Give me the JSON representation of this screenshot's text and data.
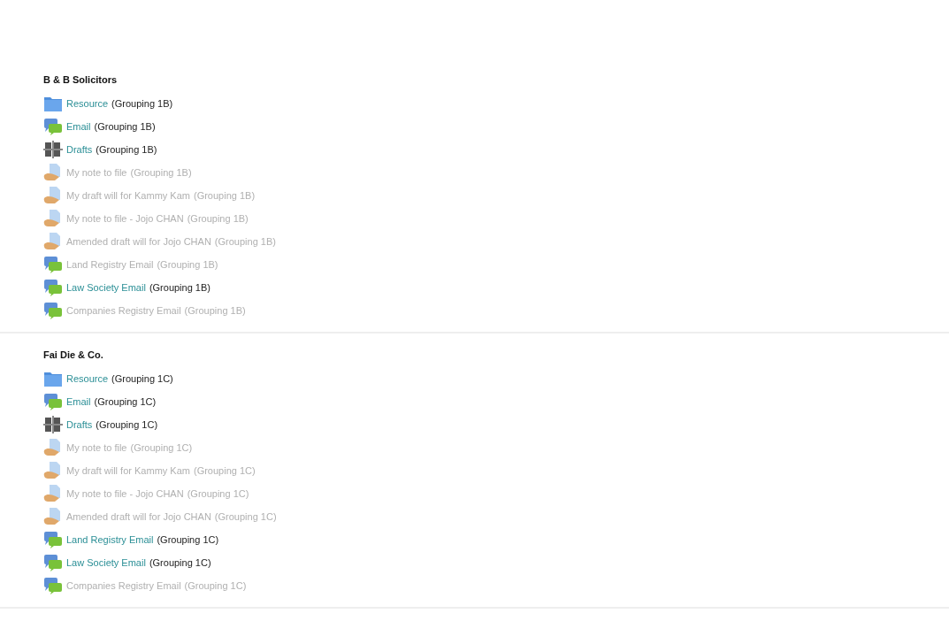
{
  "sections": [
    {
      "title": "B & B Solicitors",
      "items": [
        {
          "kind": "folder",
          "name": "Resource",
          "grouping": "(Grouping 1B)",
          "disabled": false
        },
        {
          "kind": "forum",
          "name": "Email",
          "grouping": "(Grouping 1B)",
          "disabled": false
        },
        {
          "kind": "drafts",
          "name": "Drafts",
          "grouping": "(Grouping 1B)",
          "disabled": false
        },
        {
          "kind": "assignment",
          "name": "My note to file",
          "grouping": "(Grouping 1B)",
          "disabled": true
        },
        {
          "kind": "assignment",
          "name": "My draft will for Kammy Kam",
          "grouping": "(Grouping 1B)",
          "disabled": true
        },
        {
          "kind": "assignment",
          "name": "My note to file - Jojo CHAN",
          "grouping": "(Grouping 1B)",
          "disabled": true
        },
        {
          "kind": "assignment",
          "name": "Amended draft will for Jojo CHAN",
          "grouping": "(Grouping 1B)",
          "disabled": true
        },
        {
          "kind": "forum",
          "name": "Land Registry Email",
          "grouping": "(Grouping 1B)",
          "disabled": true
        },
        {
          "kind": "forum",
          "name": "Law Society Email",
          "grouping": "(Grouping 1B)",
          "disabled": false
        },
        {
          "kind": "forum",
          "name": "Companies Registry Email",
          "grouping": "(Grouping 1B)",
          "disabled": true
        }
      ]
    },
    {
      "title": "Fai Die & Co.",
      "items": [
        {
          "kind": "folder",
          "name": "Resource",
          "grouping": "(Grouping 1C)",
          "disabled": false
        },
        {
          "kind": "forum",
          "name": "Email",
          "grouping": "(Grouping 1C)",
          "disabled": false
        },
        {
          "kind": "drafts",
          "name": "Drafts",
          "grouping": "(Grouping 1C)",
          "disabled": false
        },
        {
          "kind": "assignment",
          "name": "My note to file",
          "grouping": "(Grouping 1C)",
          "disabled": true
        },
        {
          "kind": "assignment",
          "name": "My draft will for Kammy Kam",
          "grouping": "(Grouping 1C)",
          "disabled": true
        },
        {
          "kind": "assignment",
          "name": "My note to file - Jojo CHAN",
          "grouping": "(Grouping 1C)",
          "disabled": true
        },
        {
          "kind": "assignment",
          "name": "Amended draft will for Jojo CHAN",
          "grouping": "(Grouping 1C)",
          "disabled": true
        },
        {
          "kind": "forum",
          "name": "Land Registry Email",
          "grouping": "(Grouping 1C)",
          "disabled": false
        },
        {
          "kind": "forum",
          "name": "Law Society Email",
          "grouping": "(Grouping 1C)",
          "disabled": false
        },
        {
          "kind": "forum",
          "name": "Companies Registry Email",
          "grouping": "(Grouping 1C)",
          "disabled": true
        }
      ]
    }
  ]
}
